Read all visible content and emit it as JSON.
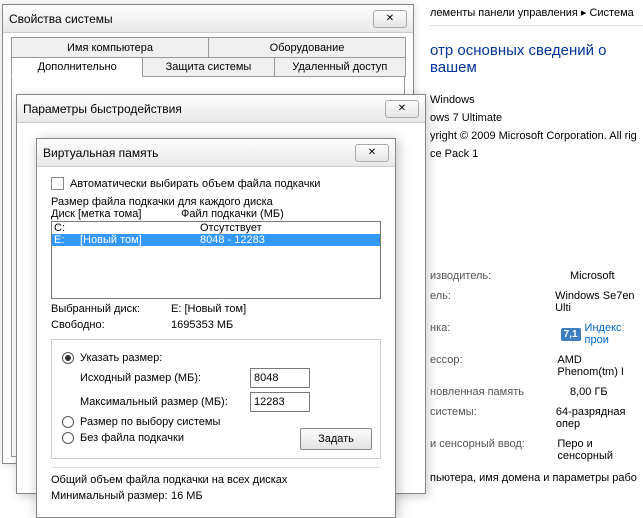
{
  "bg": {
    "breadcrumb_items": "лементы панели управления",
    "breadcrumb_sep": "▸",
    "breadcrumb_system": "Система",
    "heading": "отр основных сведений о вашем",
    "edition_label": "Windows",
    "edition_name": "ows 7 Ultimate",
    "copyright": "yright © 2009 Microsoft Corporation.  All rig",
    "sp": "ce Pack 1",
    "mfr_label": "изводитель:",
    "mfr": "Microsoft",
    "model_label": "ель:",
    "model": "Windows Se7en Ulti",
    "rating_label": "нка:",
    "rating_badge": "7,1",
    "rating_link": "Индекс прои",
    "cpu_label": "ессор:",
    "cpu": "AMD Phenom(tm) I",
    "ram_label": "новленная память",
    "ram": "8,00 ГБ",
    "sys_label": "системы:",
    "sys": "64-разрядная опер",
    "pen_label": "и сенсорный ввод:",
    "pen": "Перо и сенсорный",
    "domain": "пьютера, имя домена и параметры рабо"
  },
  "dlg1": {
    "title": "Свойства системы",
    "tabs_top": {
      "computer_name": "Имя компьютера",
      "hardware": "Оборудование"
    },
    "tabs_bottom": {
      "advanced": "Дополнительно",
      "protection": "Защита системы",
      "remote": "Удаленный доступ"
    }
  },
  "dlg2": {
    "title": "Параметры быстродействия"
  },
  "dlg3": {
    "title": "Виртуальная память",
    "auto": "Автоматически выбирать объем файла подкачки",
    "drive_hdr": "Размер файла подкачки для каждого диска",
    "col_disk": "Диск [метка тома]",
    "col_pf": "Файл подкачки (МБ)",
    "rows": [
      {
        "drv": "C:",
        "label": "",
        "pf": "Отсутствует",
        "sel": false
      },
      {
        "drv": "E:",
        "label": "[Новый том]",
        "pf": "8048 - 12283",
        "sel": true
      }
    ],
    "selected_label": "Выбранный диск:",
    "selected_val": "E:   [Новый том]",
    "free_label": "Свободно:",
    "free_val": "1695353 МБ",
    "r_custom": "Указать размер:",
    "initial_label": "Исходный размер (МБ):",
    "initial_val": "8048",
    "max_label": "Максимальный размер (МБ):",
    "max_val": "12283",
    "r_system": "Размер по выбору системы",
    "r_none": "Без файла подкачки",
    "set_btn": "Задать",
    "summary_hdr": "Общий объем файла подкачки на всех дисках",
    "min_label": "Минимальный размер:",
    "min_val": "16 МБ"
  }
}
